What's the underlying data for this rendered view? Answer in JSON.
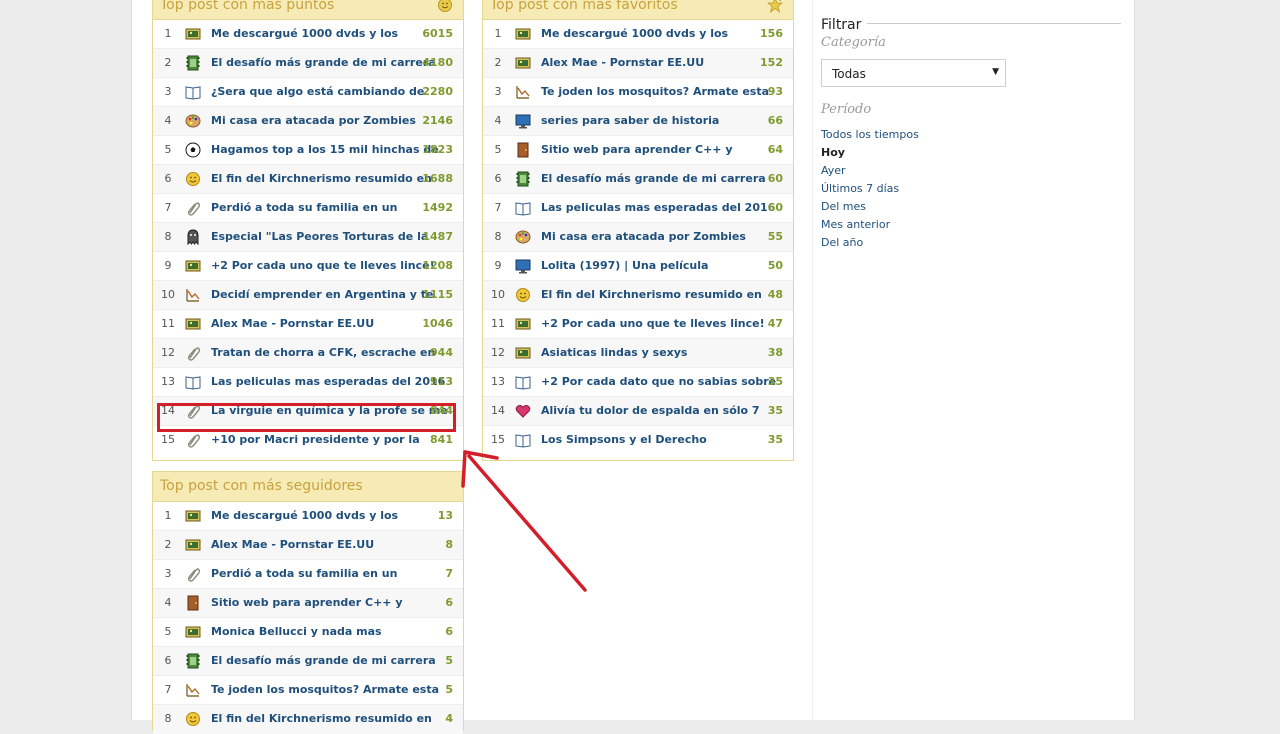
{
  "panels": {
    "puntos": {
      "title": "Top post con más puntos",
      "rows": [
        {
          "rank": "1",
          "icon": "image",
          "title": "Me descargué 1000 dvds y los",
          "value": "6015"
        },
        {
          "rank": "2",
          "icon": "film",
          "title": "El desafío más grande de mi carrera",
          "value": "4180"
        },
        {
          "rank": "3",
          "icon": "book",
          "title": "¿Sera que algo está cambiando de",
          "value": "2280"
        },
        {
          "rank": "4",
          "icon": "palette",
          "title": "Mi casa era atacada por Zombies",
          "value": "2146"
        },
        {
          "rank": "5",
          "icon": "soccer",
          "title": "Hagamos top a los 15 mil hinchas de",
          "value": "1823"
        },
        {
          "rank": "6",
          "icon": "smiley",
          "title": "El fin del Kirchnerismo resumido en",
          "value": "1688"
        },
        {
          "rank": "7",
          "icon": "paperclip",
          "title": "Perdió a toda su familia en un",
          "value": "1492"
        },
        {
          "rank": "8",
          "icon": "ghost",
          "title": "Especial \"Las Peores Torturas de la",
          "value": "1487"
        },
        {
          "rank": "9",
          "icon": "image",
          "title": "+2 Por cada uno que te lleves lince!",
          "value": "1208"
        },
        {
          "rank": "10",
          "icon": "chart",
          "title": "Decidí emprender en Argentina y te",
          "value": "1115"
        },
        {
          "rank": "11",
          "icon": "image",
          "title": "Alex Mae - Pornstar EE.UU",
          "value": "1046"
        },
        {
          "rank": "12",
          "icon": "paperclip",
          "title": "Tratan de chorra a CFK, escrache en",
          "value": "944"
        },
        {
          "rank": "13",
          "icon": "book",
          "title": "Las peliculas mas esperadas del 2016",
          "value": "913"
        },
        {
          "rank": "14",
          "icon": "paperclip",
          "title": "La virguie en química y la profe se me",
          "value": "844"
        },
        {
          "rank": "15",
          "icon": "paperclip",
          "title": "+10 por Macri presidente y por la",
          "value": "841"
        }
      ]
    },
    "favoritos": {
      "title": "Top post con más favoritos",
      "rows": [
        {
          "rank": "1",
          "icon": "image",
          "title": "Me descargué 1000 dvds y los",
          "value": "156"
        },
        {
          "rank": "2",
          "icon": "image",
          "title": "Alex Mae - Pornstar EE.UU",
          "value": "152"
        },
        {
          "rank": "3",
          "icon": "chart",
          "title": "Te joden los mosquitos? Armate esta",
          "value": "93"
        },
        {
          "rank": "4",
          "icon": "monitor",
          "title": "series para saber de historia",
          "value": "66"
        },
        {
          "rank": "5",
          "icon": "door",
          "title": "Sitio web para aprender C++ y",
          "value": "64"
        },
        {
          "rank": "6",
          "icon": "film",
          "title": "El desafío más grande de mi carrera",
          "value": "60"
        },
        {
          "rank": "7",
          "icon": "book",
          "title": "Las peliculas mas esperadas del 2016",
          "value": "60"
        },
        {
          "rank": "8",
          "icon": "palette",
          "title": "Mi casa era atacada por Zombies",
          "value": "55"
        },
        {
          "rank": "9",
          "icon": "monitor",
          "title": "Lolita (1997) | Una película",
          "value": "50"
        },
        {
          "rank": "10",
          "icon": "smiley",
          "title": "El fin del Kirchnerismo resumido en",
          "value": "48"
        },
        {
          "rank": "11",
          "icon": "image",
          "title": "+2 Por cada uno que te lleves lince!",
          "value": "47"
        },
        {
          "rank": "12",
          "icon": "image",
          "title": "Asiaticas lindas y sexys",
          "value": "38"
        },
        {
          "rank": "13",
          "icon": "book",
          "title": "+2 Por cada dato que no sabias sobre",
          "value": "35"
        },
        {
          "rank": "14",
          "icon": "heart",
          "title": "Alivía tu dolor de espalda en sólo 7",
          "value": "35"
        },
        {
          "rank": "15",
          "icon": "book",
          "title": "Los Simpsons y el Derecho",
          "value": "35"
        }
      ]
    },
    "seguidores": {
      "title": "Top post con más seguidores",
      "rows": [
        {
          "rank": "1",
          "icon": "image",
          "title": "Me descargué 1000 dvds y los",
          "value": "13"
        },
        {
          "rank": "2",
          "icon": "image",
          "title": "Alex Mae - Pornstar EE.UU",
          "value": "8"
        },
        {
          "rank": "3",
          "icon": "paperclip",
          "title": "Perdió a toda su familia en un",
          "value": "7"
        },
        {
          "rank": "4",
          "icon": "door",
          "title": "Sitio web para aprender C++ y",
          "value": "6"
        },
        {
          "rank": "5",
          "icon": "image",
          "title": "Monica Bellucci y nada mas",
          "value": "6"
        },
        {
          "rank": "6",
          "icon": "film",
          "title": "El desafío más grande de mi carrera",
          "value": "5"
        },
        {
          "rank": "7",
          "icon": "chart",
          "title": "Te joden los mosquitos? Armate esta",
          "value": "5"
        },
        {
          "rank": "8",
          "icon": "smiley",
          "title": "El fin del Kirchnerismo resumido en",
          "value": "4"
        }
      ]
    }
  },
  "filter": {
    "title": "Filtrar",
    "category_label": "Categoría",
    "category_value": "Todas",
    "period_label": "Período",
    "periods": [
      "Todos los tiempos",
      "Hoy",
      "Ayer",
      "Últimos 7 días",
      "Del mes",
      "Mes anterior",
      "Del año"
    ],
    "active_period": "Hoy"
  },
  "colors": {
    "panel_header": "#f6ebb5",
    "panel_title": "#c8a23e",
    "link": "#1f4f7b",
    "value": "#7f9a2e",
    "annotation": "#d21f2a"
  }
}
